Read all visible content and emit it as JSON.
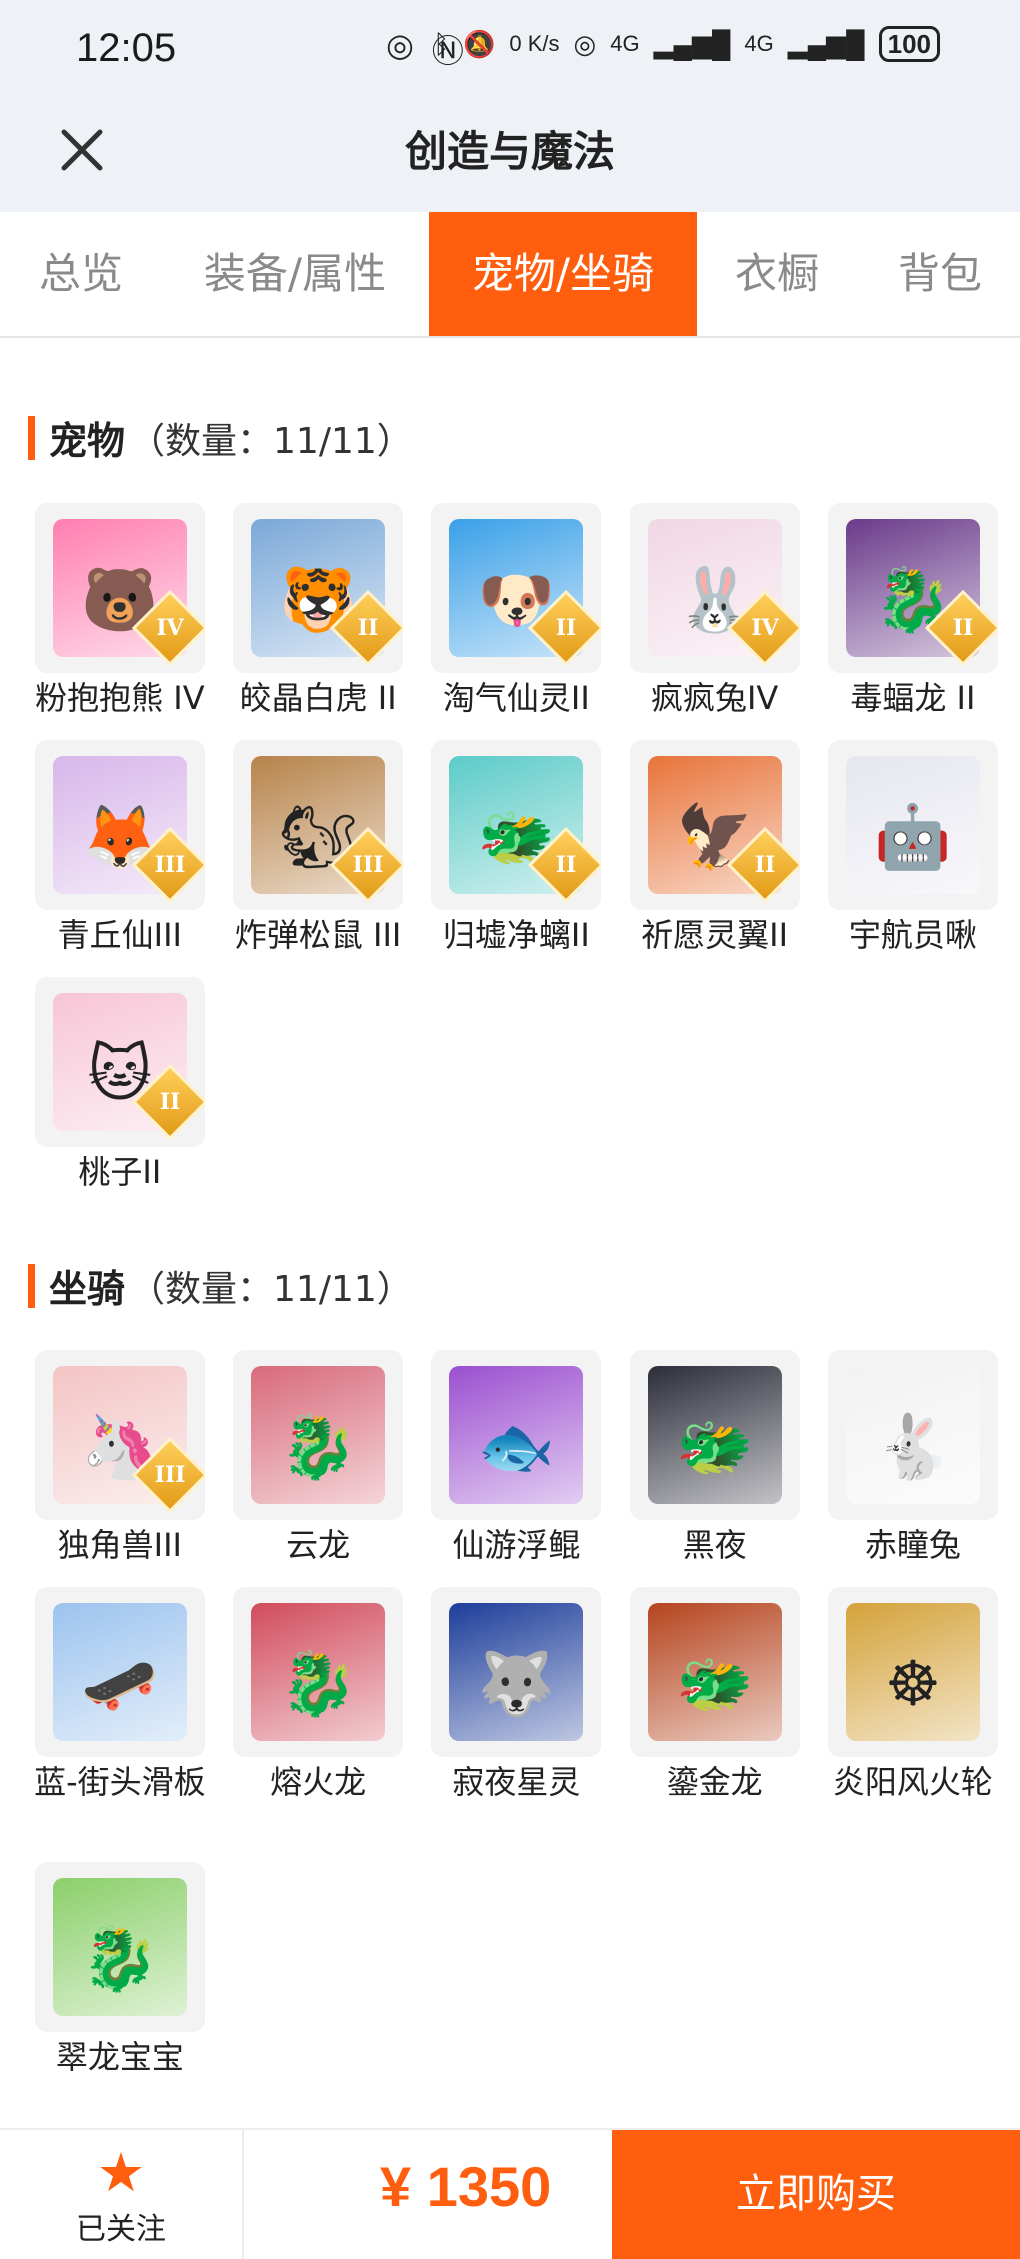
{
  "status": {
    "time": "12:05",
    "net_speed": "0 K/s",
    "battery": "100",
    "sig1": "4G",
    "sig2": "4G"
  },
  "header": {
    "title": "创造与魔法"
  },
  "tabs": [
    {
      "label": "总览"
    },
    {
      "label": "装备/属性"
    },
    {
      "label": "宠物/坐骑"
    },
    {
      "label": "衣橱"
    },
    {
      "label": "背包"
    }
  ],
  "active_tab": 2,
  "pets": {
    "label": "宠物",
    "count": "（数量：11/11）",
    "items": [
      {
        "name": "粉抱抱熊 IV",
        "badge": "IV",
        "icon": "pink-bear-icon",
        "color": "#ff7fb0",
        "glyph": "🐻"
      },
      {
        "name": "皎晶白虎 II",
        "badge": "II",
        "icon": "white-tiger-icon",
        "color": "#7aa8d8",
        "glyph": "🐯"
      },
      {
        "name": "淘气仙灵II",
        "badge": "II",
        "icon": "blue-spirit-dog-icon",
        "color": "#3aa0e8",
        "glyph": "🐶"
      },
      {
        "name": "疯疯兔IV",
        "badge": "IV",
        "icon": "crazy-rabbit-icon",
        "color": "#f1d6e4",
        "glyph": "🐰"
      },
      {
        "name": "毒蝠龙 II",
        "badge": "II",
        "icon": "bat-dragon-icon",
        "color": "#6a3a8a",
        "glyph": "🐉"
      },
      {
        "name": "青丘仙III",
        "badge": "III",
        "icon": "fox-fairy-icon",
        "color": "#d8b6ea",
        "glyph": "🦊"
      },
      {
        "name": "炸弹松鼠 III",
        "badge": "III",
        "icon": "bomb-squirrel-icon",
        "color": "#b7834a",
        "glyph": "🐿"
      },
      {
        "name": "归墟净螭II",
        "badge": "II",
        "icon": "water-dragon-icon",
        "color": "#5ccbc8",
        "glyph": "🐲"
      },
      {
        "name": "祈愿灵翼II",
        "badge": "II",
        "icon": "griffin-icon",
        "color": "#e8743a",
        "glyph": "🦅"
      },
      {
        "name": "宇航员啾",
        "badge": "",
        "icon": "astronaut-icon",
        "color": "#e6e6f0",
        "glyph": "🤖"
      },
      {
        "name": "桃子II",
        "badge": "II",
        "icon": "peach-cat-icon",
        "color": "#f7c5d6",
        "glyph": "🐱"
      }
    ]
  },
  "mounts": {
    "label": "坐骑",
    "count": "（数量：11/11）",
    "items": [
      {
        "name": "独角兽III",
        "badge": "III",
        "icon": "unicorn-icon",
        "color": "#f3c4c4",
        "glyph": "🦄"
      },
      {
        "name": "云龙",
        "badge": "",
        "icon": "cloud-dragon-icon",
        "color": "#d86a7a",
        "glyph": "🐉"
      },
      {
        "name": "仙游浮鲲",
        "badge": "",
        "icon": "flying-fish-icon",
        "color": "#9b4fd0",
        "glyph": "🐟"
      },
      {
        "name": "黑夜",
        "badge": "",
        "icon": "night-dragon-icon",
        "color": "#2b2d3a",
        "glyph": "🐲"
      },
      {
        "name": "赤瞳兔",
        "badge": "",
        "icon": "red-eye-rabbit-icon",
        "color": "#f2f2f2",
        "glyph": "🐇"
      },
      {
        "name": "蓝-街头滑板",
        "badge": "",
        "icon": "skateboard-icon",
        "color": "#9cc3ee",
        "glyph": "🛹"
      },
      {
        "name": "熔火龙",
        "badge": "",
        "icon": "lava-dragon-icon",
        "color": "#d14c5c",
        "glyph": "🐉"
      },
      {
        "name": "寂夜星灵",
        "badge": "",
        "icon": "star-wolf-icon",
        "color": "#1d3d9a",
        "glyph": "🐺"
      },
      {
        "name": "鎏金龙",
        "badge": "",
        "icon": "gold-dragon-icon",
        "color": "#b5441e",
        "glyph": "🐲"
      },
      {
        "name": "炎阳风火轮",
        "badge": "",
        "icon": "fire-wheel-icon",
        "color": "#d4a23a",
        "glyph": "☸"
      },
      {
        "name": "翠龙宝宝",
        "badge": "",
        "icon": "jade-dragon-baby-icon",
        "color": "#8bcf6a",
        "glyph": "🐉"
      }
    ]
  },
  "bottom": {
    "follow_label": "已关注",
    "price": "¥ 1350",
    "buy_label": "立即购买"
  },
  "colors": {
    "accent": "#ff5e0e"
  }
}
